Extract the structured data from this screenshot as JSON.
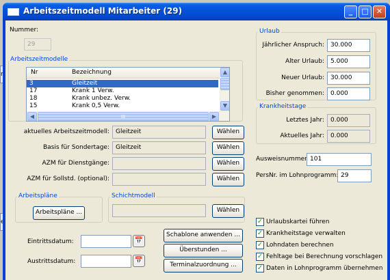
{
  "window": {
    "title": "Arbeitszeitmodell Mitarbeiter  (29)",
    "controls": {
      "minimize": "_",
      "maximize": "□",
      "close": "✕"
    }
  },
  "background": {
    "fragment1": "ne",
    "fragment2": "ech"
  },
  "nummer": {
    "label": "Nummer:",
    "value": "29"
  },
  "arbeitszeitmodelle": {
    "title": "Arbeitszeitmodelle",
    "columns": [
      "Nr",
      "Bezeichnung"
    ],
    "rows": [
      {
        "nr": "3",
        "bezeichnung": "Gleitzeit",
        "selected": true
      },
      {
        "nr": "17",
        "bezeichnung": "Krank 1 Verw.",
        "selected": false
      },
      {
        "nr": "18",
        "bezeichnung": "Krank unbez. Verw.",
        "selected": false
      },
      {
        "nr": "15",
        "bezeichnung": "Krank 0,5 Verw.",
        "selected": false
      }
    ],
    "scroll_glyph": "III"
  },
  "assignments": [
    {
      "label": "aktuelles Arbeitszeitmodell:",
      "value": "Gleitzeit",
      "button": "Wählen"
    },
    {
      "label": "Basis für Sondertage:",
      "value": "Gleitzeit",
      "button": "Wählen"
    },
    {
      "label": "AZM für Dienstgänge:",
      "value": "",
      "button": "Wählen"
    },
    {
      "label": "AZM für Sollstd. (optional):",
      "value": "",
      "button": "Wählen"
    }
  ],
  "arbeitsplaene": {
    "title": "Arbeitspläne",
    "button": "Arbeitspläne ..."
  },
  "schichtmodell": {
    "title": "Schichtmodell",
    "value": "",
    "button": "Wählen"
  },
  "eintrittsdatum": {
    "label": "Eintrittsdatum:",
    "value": ""
  },
  "austrittsdatum": {
    "label": "Austrittsdatum:",
    "value": ""
  },
  "actions": {
    "schablone": "Schablone anwenden ...",
    "ueberstunden": "Überstunden ...",
    "terminal": "Terminalzuordnung ..."
  },
  "urlaub": {
    "title": "Urlaub",
    "fields": [
      {
        "label": "Jährlicher Anspruch:",
        "value": "30.000"
      },
      {
        "label": "Alter Urlaub:",
        "value": "5.000"
      },
      {
        "label": "Neuer Urlaub:",
        "value": "30.000"
      },
      {
        "label": "Bisher genommen:",
        "value": "0.000"
      }
    ]
  },
  "krankheitstage": {
    "title": "Krankheitstage",
    "fields": [
      {
        "label": "Letztes Jahr:",
        "value": "0.000"
      },
      {
        "label": "Aktuelles Jahr:",
        "value": "0.000"
      }
    ]
  },
  "ausweisnummer": {
    "label": "Ausweisnummer:",
    "value": "101"
  },
  "persnr": {
    "label": "PersNr. im Lohnprogramm:",
    "value": "29"
  },
  "checkboxes": [
    {
      "label": "Urlaubskartei führen",
      "checked": true
    },
    {
      "label": "Krankheitstage verwalten",
      "checked": true
    },
    {
      "label": "Lohndaten berechnen",
      "checked": true
    },
    {
      "label": "Fehltage bei Berechnung vorschlagen",
      "checked": true
    },
    {
      "label": "Daten in Lohnprogramm übernehmen",
      "checked": true
    }
  ],
  "colors": {
    "titlebar": "#0451d7",
    "selection": "#316ac5",
    "group_title": "#0046d5",
    "check": "#21a121"
  }
}
